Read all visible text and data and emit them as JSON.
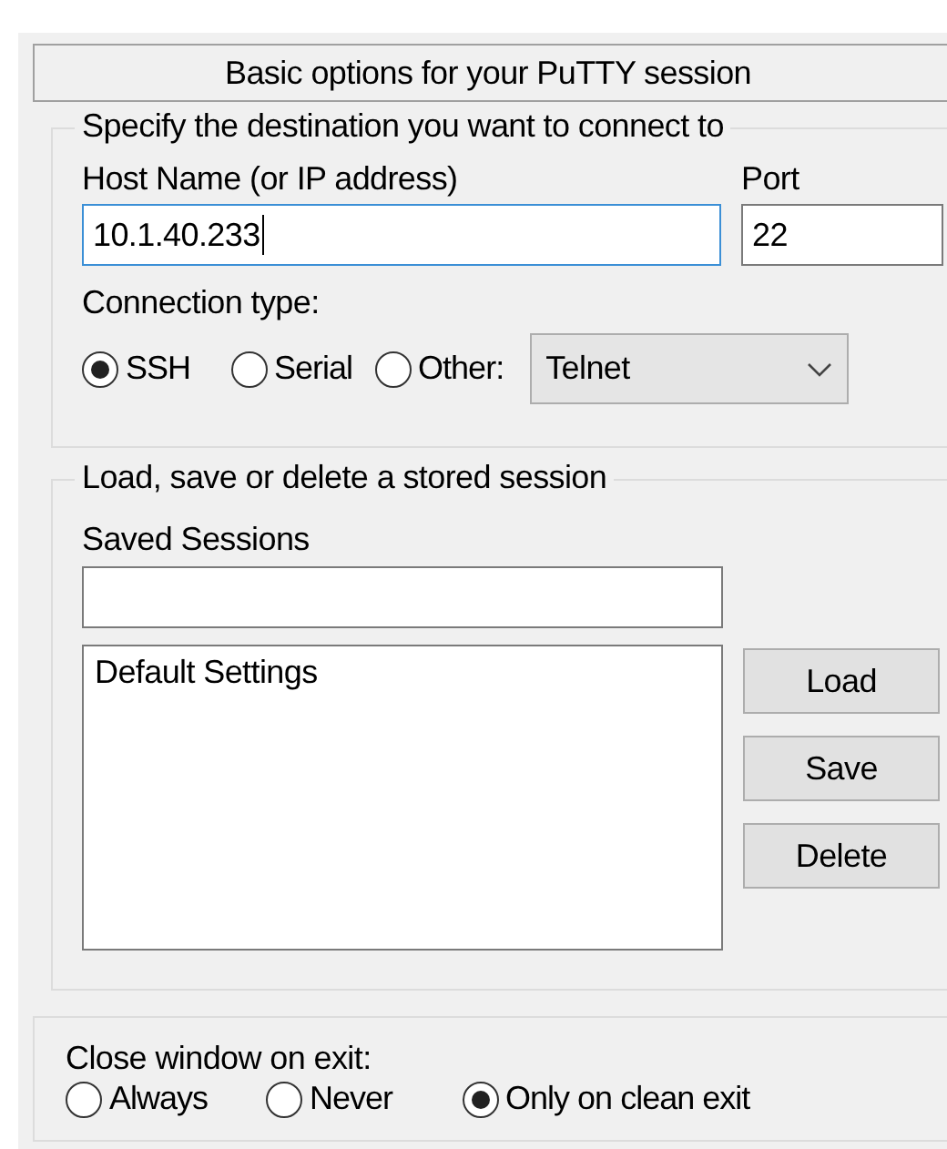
{
  "header": {
    "title": "Basic options for your PuTTY session"
  },
  "destination": {
    "legend": "Specify the destination you want to connect to",
    "host": {
      "label": "Host Name (or IP address)",
      "value": "10.1.40.233",
      "focused": true
    },
    "port": {
      "label": "Port",
      "value": "22"
    },
    "connection_type": {
      "label": "Connection type:",
      "options": [
        {
          "label": "SSH",
          "selected": true
        },
        {
          "label": "Serial",
          "selected": false
        },
        {
          "label": "Other:",
          "selected": false
        }
      ],
      "protocol": {
        "value": "Telnet"
      }
    }
  },
  "sessions": {
    "legend": "Load, save or delete a stored session",
    "saved_label": "Saved Sessions",
    "list": [
      {
        "label": "Default Settings"
      }
    ],
    "buttons": [
      {
        "label": "Load"
      },
      {
        "label": "Save"
      },
      {
        "label": "Delete"
      }
    ]
  },
  "close_on_exit": {
    "label": "Close window on exit:",
    "options": [
      {
        "label": "Always",
        "selected": false
      },
      {
        "label": "Never",
        "selected": false
      },
      {
        "label": "Only on clean exit",
        "selected": true
      }
    ]
  }
}
